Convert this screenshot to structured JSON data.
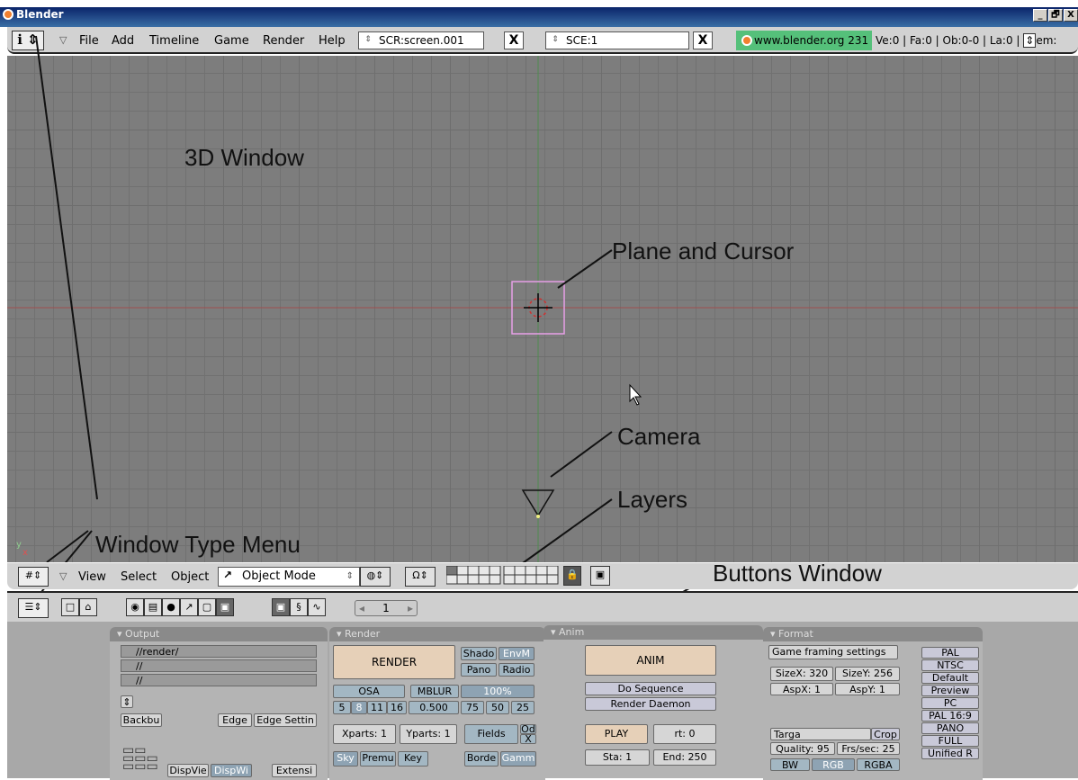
{
  "window": {
    "title": "Blender",
    "minimize": "_",
    "maximize": "🗗",
    "close": "X"
  },
  "info_header": {
    "menus": [
      "File",
      "Add",
      "Timeline",
      "Game",
      "Render",
      "Help"
    ],
    "screen_field": "SCR:screen.001",
    "scene_field": "SCE:1",
    "delete_glyph": "X",
    "website": "www.blender.org 231",
    "stats": "Ve:0 | Fa:0 | Ob:0-0 | La:0 | ",
    "stats_tail": "em:"
  },
  "annotations": {
    "window3d": "3D Window",
    "plane_cursor": "Plane and Cursor",
    "camera": "Camera",
    "layers": "Layers",
    "window_type_menu": "Window Type Menu",
    "buttons_window": "Buttons Window"
  },
  "axis": {
    "y": "y",
    "x": "x"
  },
  "view3d_header": {
    "menus": [
      "View",
      "Select",
      "Object"
    ],
    "mode": "Object Mode"
  },
  "buttons_header": {
    "frame": "1",
    "arrow_left": "◂",
    "arrow_right": "▸"
  },
  "output_panel": {
    "title": "Output",
    "paths": [
      "//render/",
      "//",
      "//"
    ],
    "backbuf": "Backbu",
    "edge": "Edge",
    "edge_settings": "Edge Settin",
    "dispview": "DispVie",
    "dispwin": "DispWi",
    "extensions": "Extensi"
  },
  "render_panel": {
    "title": "Render",
    "render": "RENDER",
    "shadow": "Shado",
    "envmap": "EnvM",
    "pano": "Pano",
    "radio": "Radio",
    "osa": "OSA",
    "mblur": "MBLUR",
    "percent": "100%",
    "osa_levels": [
      "5",
      "8",
      "11",
      "16"
    ],
    "blur_factor": "0.500",
    "size_presets": [
      "75",
      "50",
      "25"
    ],
    "xparts": "Xparts: 1",
    "yparts": "Yparts: 1",
    "fields": "Fields",
    "odd": "Od",
    "x": "X",
    "sky": "Sky",
    "premul": "Premu",
    "key": "Key",
    "border": "Borde",
    "gamma": "Gamm"
  },
  "anim_panel": {
    "title": "Anim",
    "anim": "ANIM",
    "do_sequence": "Do Sequence",
    "render_daemon": "Render Daemon",
    "play": "PLAY",
    "rt": "rt: 0",
    "start": "Sta: 1",
    "end": "End: 250"
  },
  "format_panel": {
    "title": "Format",
    "game_framing": "Game framing settings",
    "sizex": "SizeX: 320",
    "sizey": "SizeY: 256",
    "aspx": "AspX: 1",
    "aspy": "AspY: 1",
    "filetype": "Targa",
    "crop": "Crop",
    "quality": "Quality: 95",
    "fps": "Frs/sec: 25",
    "bw": "BW",
    "rgb": "RGB",
    "rgba": "RGBA",
    "presets": [
      "PAL",
      "NTSC",
      "Default",
      "Preview",
      "PC",
      "PAL 16:9",
      "PANO",
      "FULL",
      "Unified R"
    ]
  }
}
